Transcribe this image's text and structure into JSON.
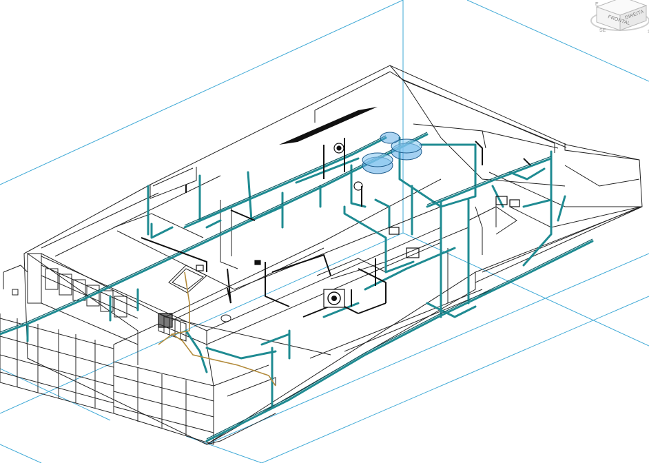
{
  "viewcube": {
    "front_label": "FRONTAL",
    "right_label": "DIREITA",
    "compass_east": "E",
    "compass_south": "SE",
    "compass_west": "S"
  },
  "colors": {
    "background": "#ffffff",
    "section_box": "#3fa9d6",
    "building_edges": "#222222",
    "water_pipe": "#1f8b92",
    "water_pipe_dark": "#0c5a63",
    "gas_pipe": "#b28a3a",
    "water_tank": "#5aa9e6",
    "solar_panel": "#111111"
  }
}
